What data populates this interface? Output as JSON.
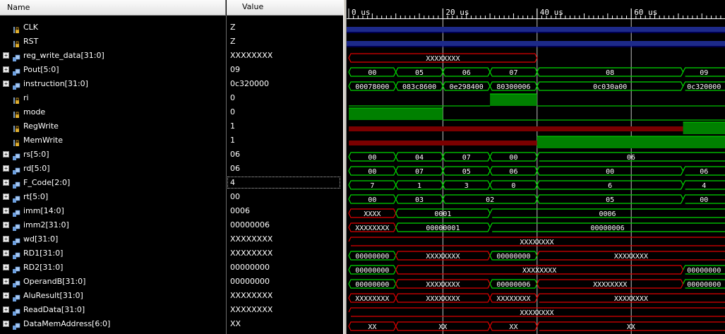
{
  "header": {
    "name_label": "Name",
    "value_label": "Value"
  },
  "ruler": {
    "labels": [
      "0 us",
      "20 us",
      "40 us",
      "60 us"
    ]
  },
  "colors": {
    "bus": "#00d800",
    "bus_unknown": "#e00000",
    "clock": "#1d2a8a",
    "logic_high": "#008000",
    "logic_low_wave": "#00c000",
    "logic_x": "#7a0000"
  },
  "signals": [
    {
      "name": "CLK",
      "value": "Z",
      "kind": "bit",
      "icon": "bit-signal-icon"
    },
    {
      "name": "RST",
      "value": "Z",
      "kind": "bit",
      "icon": "bit-signal-icon"
    },
    {
      "name": "reg_write_data[31:0]",
      "value": "XXXXXXXX",
      "kind": "bus",
      "icon": "bus-signal-icon"
    },
    {
      "name": "Pout[5:0]",
      "value": "09",
      "kind": "bus",
      "icon": "bus-signal-icon"
    },
    {
      "name": "instruction[31:0]",
      "value": "0c320000",
      "kind": "bus",
      "icon": "bus-signal-icon"
    },
    {
      "name": "ri",
      "value": "0",
      "kind": "bit",
      "icon": "bit-signal-icon"
    },
    {
      "name": "mode",
      "value": "0",
      "kind": "bit",
      "icon": "bit-signal-icon"
    },
    {
      "name": "RegWrite",
      "value": "1",
      "kind": "bit",
      "icon": "bit-signal-icon"
    },
    {
      "name": "MemWrite",
      "value": "1",
      "kind": "bit",
      "icon": "bit-signal-icon"
    },
    {
      "name": "rs[5:0]",
      "value": "06",
      "kind": "bus",
      "icon": "bus-signal-icon"
    },
    {
      "name": "rd[5:0]",
      "value": "06",
      "kind": "bus",
      "icon": "bus-signal-icon"
    },
    {
      "name": "F_Code[2:0]",
      "value": "4",
      "kind": "bus",
      "icon": "bus-signal-icon",
      "selected": true
    },
    {
      "name": "rt[5:0]",
      "value": "00",
      "kind": "bus",
      "icon": "bus-signal-icon"
    },
    {
      "name": "imm[14:0]",
      "value": "0006",
      "kind": "bus",
      "icon": "bus-signal-icon"
    },
    {
      "name": "imm2[31:0]",
      "value": "00000006",
      "kind": "bus",
      "icon": "bus-signal-icon"
    },
    {
      "name": "wd[31:0]",
      "value": "XXXXXXXX",
      "kind": "bus",
      "icon": "bus-signal-icon"
    },
    {
      "name": "RD1[31:0]",
      "value": "XXXXXXXX",
      "kind": "bus",
      "icon": "bus-signal-icon"
    },
    {
      "name": "RD2[31:0]",
      "value": "00000000",
      "kind": "bus",
      "icon": "bus-signal-icon"
    },
    {
      "name": "OperandB[31:0]",
      "value": "00000000",
      "kind": "bus",
      "icon": "bus-signal-icon"
    },
    {
      "name": "AluResult[31:0]",
      "value": "XXXXXXXX",
      "kind": "bus",
      "icon": "bus-signal-icon"
    },
    {
      "name": "ReadData[31:0]",
      "value": "XXXXXXXX",
      "kind": "bus",
      "icon": "bus-signal-icon"
    },
    {
      "name": "DataMemAddress[6:0]",
      "value": "XX",
      "kind": "bus",
      "icon": "bus-signal-icon"
    }
  ],
  "waves": [
    {
      "type": "clock"
    },
    {
      "type": "clock"
    },
    {
      "type": "bus",
      "segs": [
        {
          "s": 0,
          "e": 80,
          "v": "XXXXXXXX",
          "x": true
        }
      ]
    },
    {
      "type": "bus",
      "segs": [
        {
          "s": 0,
          "e": 20,
          "v": "00"
        },
        {
          "s": 20,
          "e": 40,
          "v": "05"
        },
        {
          "s": 40,
          "e": 60,
          "v": "06"
        },
        {
          "s": 60,
          "e": 80,
          "v": "07"
        },
        {
          "s": 80,
          "e": 142,
          "v": "08"
        },
        {
          "s": 142,
          "e": 160,
          "v": "09"
        }
      ]
    },
    {
      "type": "bus",
      "segs": [
        {
          "s": 0,
          "e": 20,
          "v": "00078000"
        },
        {
          "s": 20,
          "e": 40,
          "v": "083c8600"
        },
        {
          "s": 40,
          "e": 60,
          "v": "0e298400"
        },
        {
          "s": 60,
          "e": 80,
          "v": "80300006"
        },
        {
          "s": 80,
          "e": 142,
          "v": "0c030a00"
        },
        {
          "s": 142,
          "e": 160,
          "v": "0c320000"
        }
      ]
    },
    {
      "type": "bit",
      "segs": [
        {
          "s": 0,
          "e": 60,
          "l": 0
        },
        {
          "s": 60,
          "e": 80,
          "l": 1
        },
        {
          "s": 80,
          "e": 160,
          "l": 0
        }
      ]
    },
    {
      "type": "bit",
      "segs": [
        {
          "s": 0,
          "e": 40,
          "l": 1
        },
        {
          "s": 40,
          "e": 160,
          "l": 0
        }
      ]
    },
    {
      "type": "bit",
      "segs": [
        {
          "s": 0,
          "e": 142,
          "l": "x"
        },
        {
          "s": 142,
          "e": 160,
          "l": 1
        }
      ]
    },
    {
      "type": "bit",
      "segs": [
        {
          "s": 0,
          "e": 80,
          "l": "x"
        },
        {
          "s": 80,
          "e": 160,
          "l": 1
        }
      ]
    },
    {
      "type": "bus",
      "segs": [
        {
          "s": 0,
          "e": 20,
          "v": "00"
        },
        {
          "s": 20,
          "e": 40,
          "v": "04"
        },
        {
          "s": 40,
          "e": 60,
          "v": "07"
        },
        {
          "s": 60,
          "e": 80,
          "v": "00"
        },
        {
          "s": 80,
          "e": 160,
          "v": "06"
        }
      ]
    },
    {
      "type": "bus",
      "segs": [
        {
          "s": 0,
          "e": 20,
          "v": "00"
        },
        {
          "s": 20,
          "e": 40,
          "v": "07"
        },
        {
          "s": 40,
          "e": 60,
          "v": "05"
        },
        {
          "s": 60,
          "e": 80,
          "v": "06"
        },
        {
          "s": 80,
          "e": 142,
          "v": "00"
        },
        {
          "s": 142,
          "e": 160,
          "v": "06"
        }
      ]
    },
    {
      "type": "bus",
      "segs": [
        {
          "s": 0,
          "e": 20,
          "v": "7"
        },
        {
          "s": 20,
          "e": 40,
          "v": "1"
        },
        {
          "s": 40,
          "e": 60,
          "v": "3"
        },
        {
          "s": 60,
          "e": 80,
          "v": "0"
        },
        {
          "s": 80,
          "e": 142,
          "v": "6"
        },
        {
          "s": 142,
          "e": 160,
          "v": "4"
        }
      ]
    },
    {
      "type": "bus",
      "segs": [
        {
          "s": 0,
          "e": 20,
          "v": "00"
        },
        {
          "s": 20,
          "e": 40,
          "v": "03"
        },
        {
          "s": 40,
          "e": 80,
          "v": "02"
        },
        {
          "s": 80,
          "e": 142,
          "v": "05"
        },
        {
          "s": 142,
          "e": 160,
          "v": "00"
        }
      ]
    },
    {
      "type": "bus",
      "segs": [
        {
          "s": 0,
          "e": 20,
          "v": "XXXX",
          "x": true
        },
        {
          "s": 20,
          "e": 60,
          "v": "0001"
        },
        {
          "s": 60,
          "e": 160,
          "v": "0006"
        }
      ]
    },
    {
      "type": "bus",
      "segs": [
        {
          "s": 0,
          "e": 20,
          "v": "XXXXXXXX",
          "x": true
        },
        {
          "s": 20,
          "e": 60,
          "v": "00000001"
        },
        {
          "s": 60,
          "e": 160,
          "v": "00000006"
        }
      ]
    },
    {
      "type": "bus",
      "segs": [
        {
          "s": 0,
          "e": 160,
          "v": "XXXXXXXX",
          "x": true
        }
      ]
    },
    {
      "type": "bus",
      "segs": [
        {
          "s": 0,
          "e": 20,
          "v": "00000000"
        },
        {
          "s": 20,
          "e": 60,
          "v": "XXXXXXXX",
          "x": true
        },
        {
          "s": 60,
          "e": 80,
          "v": "00000000"
        },
        {
          "s": 80,
          "e": 160,
          "v": "XXXXXXXX",
          "x": true
        }
      ]
    },
    {
      "type": "bus",
      "segs": [
        {
          "s": 0,
          "e": 20,
          "v": "00000000"
        },
        {
          "s": 20,
          "e": 142,
          "v": "XXXXXXXX",
          "x": true
        },
        {
          "s": 142,
          "e": 160,
          "v": "00000000"
        }
      ]
    },
    {
      "type": "bus",
      "segs": [
        {
          "s": 0,
          "e": 20,
          "v": "00000000"
        },
        {
          "s": 20,
          "e": 60,
          "v": "XXXXXXXX",
          "x": true
        },
        {
          "s": 60,
          "e": 80,
          "v": "00000006"
        },
        {
          "s": 80,
          "e": 142,
          "v": "XXXXXXXX",
          "x": true
        },
        {
          "s": 142,
          "e": 160,
          "v": "00000000"
        }
      ]
    },
    {
      "type": "bus",
      "segs": [
        {
          "s": 0,
          "e": 20,
          "v": "XXXXXXXX",
          "x": true
        },
        {
          "s": 20,
          "e": 60,
          "v": "XXXXXXXX",
          "x": true
        },
        {
          "s": 60,
          "e": 80,
          "v": "XXXXXXXX",
          "x": true
        },
        {
          "s": 80,
          "e": 160,
          "v": "XXXXXXXX",
          "x": true
        }
      ]
    },
    {
      "type": "bus",
      "segs": [
        {
          "s": 0,
          "e": 160,
          "v": "XXXXXXXX",
          "x": true
        }
      ]
    },
    {
      "type": "bus",
      "segs": [
        {
          "s": 0,
          "e": 20,
          "v": "XX",
          "x": true
        },
        {
          "s": 20,
          "e": 60,
          "v": "XX",
          "x": true
        },
        {
          "s": 60,
          "e": 80,
          "v": "XX",
          "x": true
        },
        {
          "s": 80,
          "e": 160,
          "v": "XX",
          "x": true
        }
      ]
    }
  ]
}
